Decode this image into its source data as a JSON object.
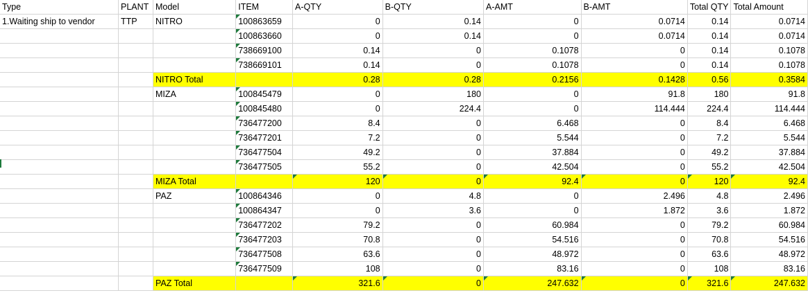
{
  "headers": [
    "Type",
    "PLANT",
    "Model",
    "ITEM",
    "A-QTY",
    "B-QTY",
    "A-AMT",
    "B-AMT",
    "Total QTY",
    "Total Amount"
  ],
  "rows": [
    {
      "kind": "item",
      "type": "1.Waiting ship to vendor",
      "plant": "TTP",
      "model": "NITRO",
      "item": "100863659",
      "a_qty": "0",
      "b_qty": "0.14",
      "a_amt": "0",
      "b_amt": "0.0714",
      "total_qty": "0.14",
      "total_amount": "0.0714"
    },
    {
      "kind": "item",
      "type": "",
      "plant": "",
      "model": "",
      "item": "100863660",
      "a_qty": "0",
      "b_qty": "0.14",
      "a_amt": "0",
      "b_amt": "0.0714",
      "total_qty": "0.14",
      "total_amount": "0.0714"
    },
    {
      "kind": "item",
      "type": "",
      "plant": "",
      "model": "",
      "item": "738669100",
      "a_qty": "0.14",
      "b_qty": "0",
      "a_amt": "0.1078",
      "b_amt": "0",
      "total_qty": "0.14",
      "total_amount": "0.1078"
    },
    {
      "kind": "item",
      "type": "",
      "plant": "",
      "model": "",
      "item": "738669101",
      "a_qty": "0.14",
      "b_qty": "0",
      "a_amt": "0.1078",
      "b_amt": "0",
      "total_qty": "0.14",
      "total_amount": "0.1078"
    },
    {
      "kind": "total",
      "type": "",
      "plant": "",
      "model": "NITRO Total",
      "item": "",
      "a_qty": "0.28",
      "b_qty": "0.28",
      "a_amt": "0.2156",
      "b_amt": "0.1428",
      "total_qty": "0.56",
      "total_amount": "0.3584"
    },
    {
      "kind": "item",
      "type": "",
      "plant": "",
      "model": "MIZA",
      "item": "100845479",
      "a_qty": "0",
      "b_qty": "180",
      "a_amt": "0",
      "b_amt": "91.8",
      "total_qty": "180",
      "total_amount": "91.8"
    },
    {
      "kind": "item",
      "type": "",
      "plant": "",
      "model": "",
      "item": "100845480",
      "a_qty": "0",
      "b_qty": "224.4",
      "a_amt": "0",
      "b_amt": "114.444",
      "total_qty": "224.4",
      "total_amount": "114.444"
    },
    {
      "kind": "item",
      "type": "",
      "plant": "",
      "model": "",
      "item": "736477200",
      "a_qty": "8.4",
      "b_qty": "0",
      "a_amt": "6.468",
      "b_amt": "0",
      "total_qty": "8.4",
      "total_amount": "6.468"
    },
    {
      "kind": "item",
      "type": "",
      "plant": "",
      "model": "",
      "item": "736477201",
      "a_qty": "7.2",
      "b_qty": "0",
      "a_amt": "5.544",
      "b_amt": "0",
      "total_qty": "7.2",
      "total_amount": "5.544"
    },
    {
      "kind": "item",
      "type": "",
      "plant": "",
      "model": "",
      "item": "736477504",
      "a_qty": "49.2",
      "b_qty": "0",
      "a_amt": "37.884",
      "b_amt": "0",
      "total_qty": "49.2",
      "total_amount": "37.884"
    },
    {
      "kind": "item",
      "type": "",
      "plant": "",
      "model": "",
      "item": "736477505",
      "a_qty": "55.2",
      "b_qty": "0",
      "a_amt": "42.504",
      "b_amt": "0",
      "total_qty": "55.2",
      "total_amount": "42.504"
    },
    {
      "kind": "total",
      "type": "",
      "plant": "",
      "model": "MIZA Total",
      "item": "",
      "a_qty": "120",
      "b_qty": "0",
      "a_amt": "92.4",
      "b_amt": "0",
      "total_qty": "120",
      "total_amount": "92.4"
    },
    {
      "kind": "item",
      "type": "",
      "plant": "",
      "model": "PAZ",
      "item": "100864346",
      "a_qty": "0",
      "b_qty": "4.8",
      "a_amt": "0",
      "b_amt": "2.496",
      "total_qty": "4.8",
      "total_amount": "2.496"
    },
    {
      "kind": "item",
      "type": "",
      "plant": "",
      "model": "",
      "item": "100864347",
      "a_qty": "0",
      "b_qty": "3.6",
      "a_amt": "0",
      "b_amt": "1.872",
      "total_qty": "3.6",
      "total_amount": "1.872"
    },
    {
      "kind": "item",
      "type": "",
      "plant": "",
      "model": "",
      "item": "736477202",
      "a_qty": "79.2",
      "b_qty": "0",
      "a_amt": "60.984",
      "b_amt": "0",
      "total_qty": "79.2",
      "total_amount": "60.984"
    },
    {
      "kind": "item",
      "type": "",
      "plant": "",
      "model": "",
      "item": "736477203",
      "a_qty": "70.8",
      "b_qty": "0",
      "a_amt": "54.516",
      "b_amt": "0",
      "total_qty": "70.8",
      "total_amount": "54.516"
    },
    {
      "kind": "item",
      "type": "",
      "plant": "",
      "model": "",
      "item": "736477508",
      "a_qty": "63.6",
      "b_qty": "0",
      "a_amt": "48.972",
      "b_amt": "0",
      "total_qty": "63.6",
      "total_amount": "48.972"
    },
    {
      "kind": "item",
      "type": "",
      "plant": "",
      "model": "",
      "item": "736477509",
      "a_qty": "108",
      "b_qty": "0",
      "a_amt": "83.16",
      "b_amt": "0",
      "total_qty": "108",
      "total_amount": "83.16"
    },
    {
      "kind": "total",
      "type": "",
      "plant": "",
      "model": "PAZ Total",
      "item": "",
      "a_qty": "321.6",
      "b_qty": "0",
      "a_amt": "247.632",
      "b_amt": "0",
      "total_qty": "321.6",
      "total_amount": "247.632"
    }
  ],
  "colors": {
    "highlight": "#ffff00",
    "gridline": "#d4d4d4",
    "marker": "#1e7a3c"
  }
}
